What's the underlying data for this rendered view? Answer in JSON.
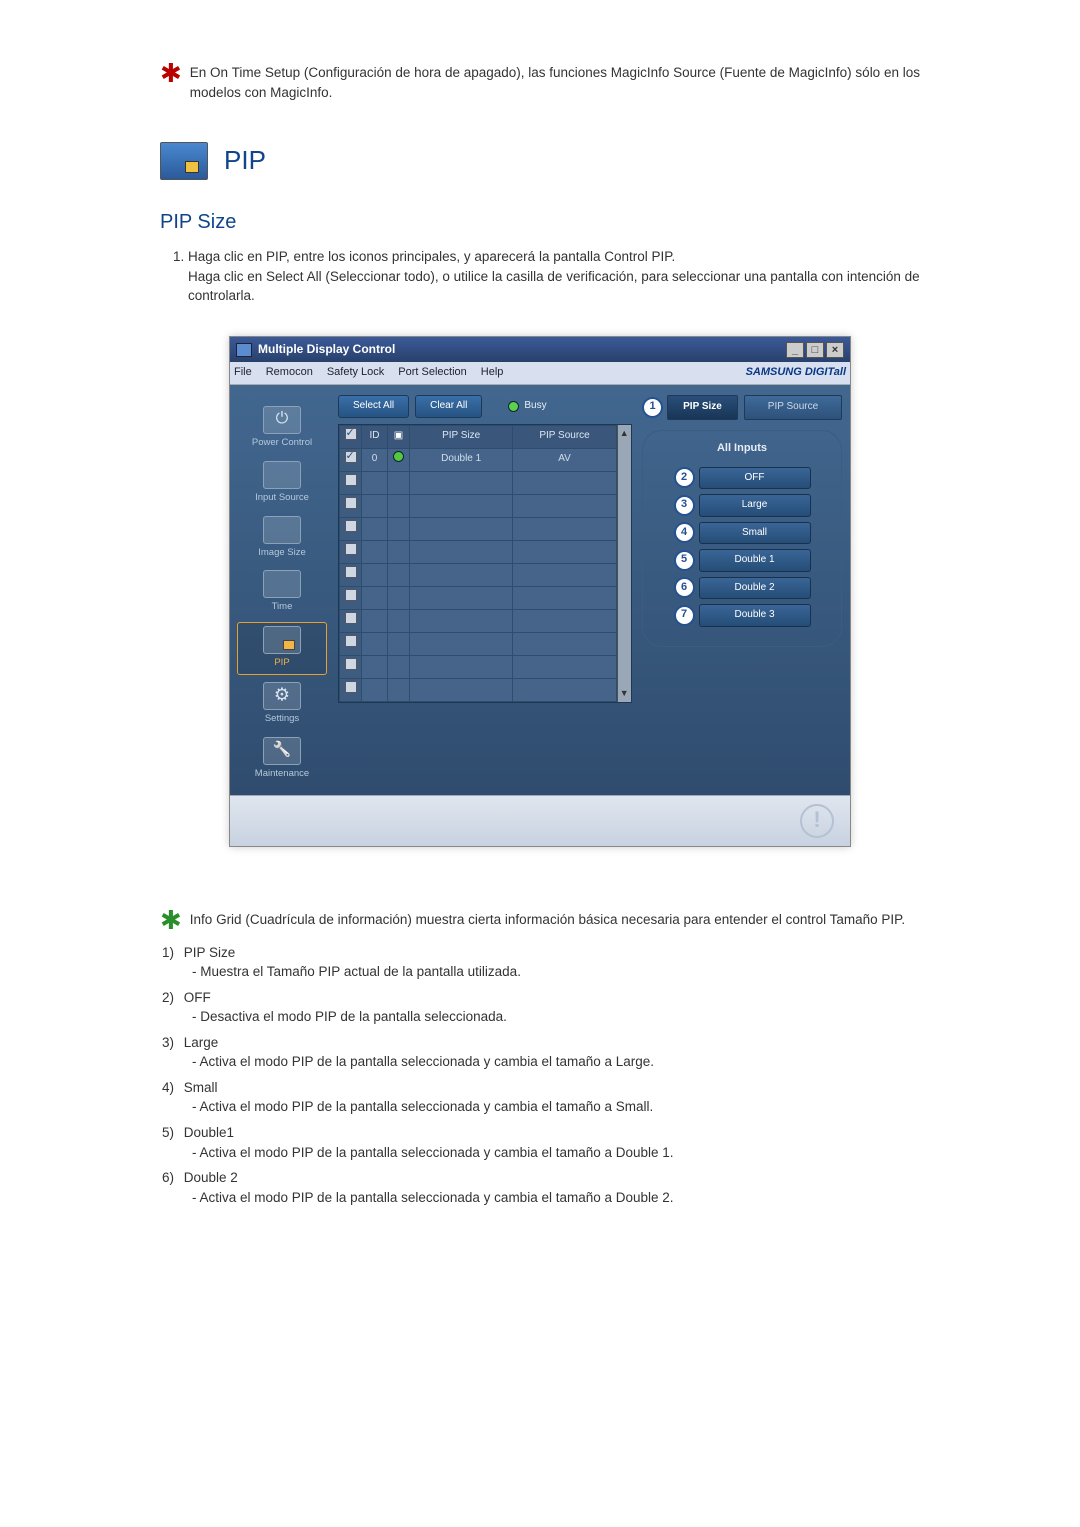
{
  "top_note": "En On Time Setup (Configuración de hora de apagado), las funciones MagicInfo Source (Fuente de MagicInfo) sólo en los modelos con MagicInfo.",
  "section": {
    "title": "PIP",
    "subtitle": "PIP Size"
  },
  "intro": {
    "li1_a": "Haga clic en PIP, entre los iconos principales, y aparecerá la pantalla Control PIP.",
    "li1_b": "Haga clic en Select All (Seleccionar todo), o utilice la casilla de verificación, para seleccionar una pantalla con intención de controlarla."
  },
  "app": {
    "title": "Multiple Display Control",
    "menubar": {
      "file": "File",
      "remocon": "Remocon",
      "safety": "Safety Lock",
      "port": "Port Selection",
      "help": "Help",
      "brand": "SAMSUNG DIGITall"
    },
    "sidebar": {
      "power": "Power Control",
      "input": "Input Source",
      "image": "Image Size",
      "time": "Time",
      "pip": "PIP",
      "settings": "Settings",
      "maint": "Maintenance"
    },
    "toolbar": {
      "select_all": "Select All",
      "clear_all": "Clear All",
      "busy": "Busy"
    },
    "grid": {
      "headers": {
        "chk": "☑",
        "id": "ID",
        "status": "",
        "pip_size": "PIP Size",
        "pip_source": "PIP Source"
      },
      "row0": {
        "id": "0",
        "pip_size": "Double 1",
        "pip_source": "AV"
      }
    },
    "panel": {
      "tab_size": "PIP Size",
      "tab_source": "PIP Source",
      "group_title": "All Inputs",
      "badge1": "1",
      "badge2": "2",
      "badge3": "3",
      "badge4": "4",
      "badge5": "5",
      "badge6": "6",
      "badge7": "7",
      "opt_off": "OFF",
      "opt_large": "Large",
      "opt_small": "Small",
      "opt_d1": "Double 1",
      "opt_d2": "Double 2",
      "opt_d3": "Double 3"
    },
    "warn": "!"
  },
  "expl": {
    "note": "Info Grid (Cuadrícula de información) muestra cierta información básica necesaria para entender el control Tamaño PIP.",
    "items": [
      {
        "num": "1)",
        "title": "PIP Size",
        "desc": "- Muestra el Tamaño PIP actual de la pantalla utilizada."
      },
      {
        "num": "2)",
        "title": "OFF",
        "desc": "- Desactiva el modo PIP de la pantalla seleccionada."
      },
      {
        "num": "3)",
        "title": "Large",
        "desc": "- Activa el modo PIP de la pantalla seleccionada y cambia el tamaño a Large."
      },
      {
        "num": "4)",
        "title": "Small",
        "desc": "- Activa el modo PIP de la pantalla seleccionada y cambia el tamaño a Small."
      },
      {
        "num": "5)",
        "title": "Double1",
        "desc": "- Activa el modo PIP de la pantalla seleccionada y cambia el tamaño a Double 1."
      },
      {
        "num": "6)",
        "title": "Double 2",
        "desc": "- Activa el modo PIP de la pantalla seleccionada y cambia el tamaño a Double 2."
      }
    ]
  }
}
